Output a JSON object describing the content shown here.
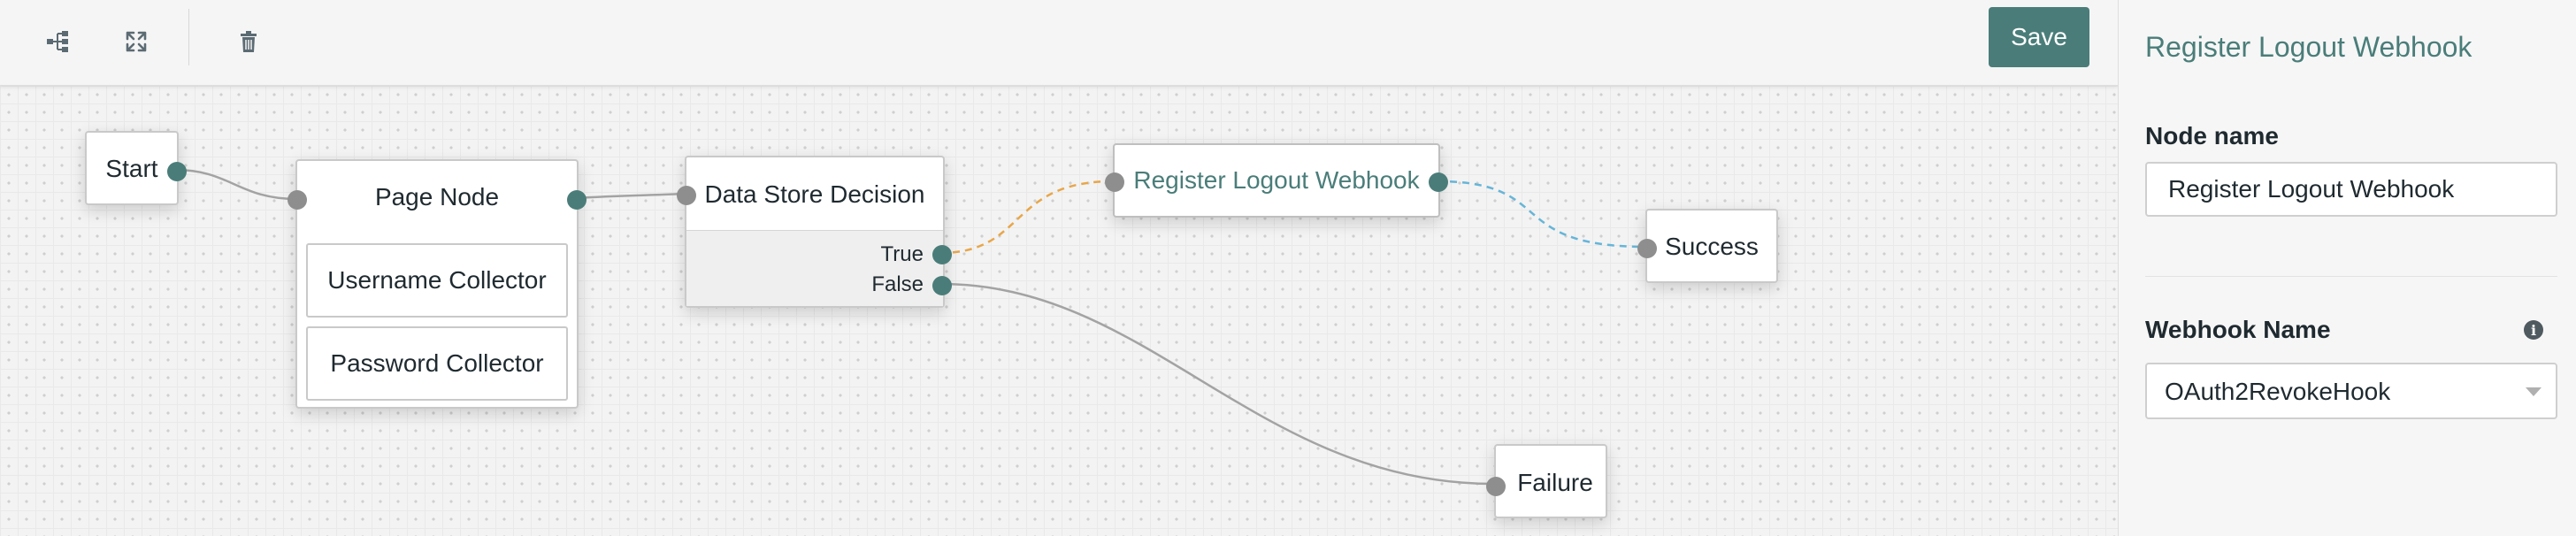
{
  "toolbar": {
    "icons": [
      "tree-layout-icon",
      "fullscreen-expand-icon",
      "trash-icon"
    ],
    "save_label": "Save"
  },
  "canvas": {
    "nodes": {
      "start": {
        "title": "Start"
      },
      "page_node": {
        "title": "Page Node",
        "children": [
          "Username Collector",
          "Password Collector"
        ]
      },
      "data_store": {
        "title": "Data Store Decision",
        "outcome_true": "True",
        "outcome_false": "False"
      },
      "webhook": {
        "title": "Register Logout Webhook",
        "selected": true
      },
      "success": {
        "title": "Success"
      },
      "failure": {
        "title": "Failure"
      }
    },
    "edge_colors": {
      "default": "#a3a3a3",
      "true_branch": "#e8a64a",
      "selected": "#66b5d8"
    }
  },
  "side_panel": {
    "title": "Register Logout Webhook",
    "node_name_label": "Node name",
    "node_name_value": "Register Logout Webhook",
    "webhook_label": "Webhook Name",
    "webhook_value": "OAuth2RevokeHook",
    "info_icon": "info-icon"
  },
  "colors": {
    "accent": "#4a7d79"
  }
}
